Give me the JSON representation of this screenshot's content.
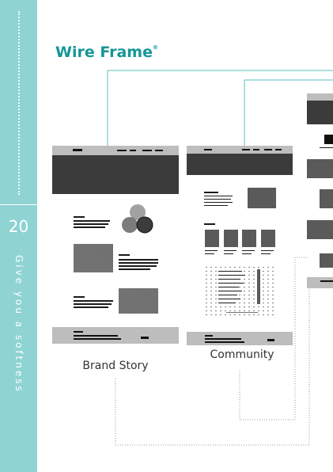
{
  "sidebar": {
    "page_number": "20",
    "tagline": "Give you a softness"
  },
  "title": {
    "text": "Wire Frame",
    "mark": "®"
  },
  "wireframes": [
    {
      "caption": "Brand Story"
    },
    {
      "caption": "Community"
    }
  ],
  "colors": {
    "sidebar": "#8fd3d3",
    "title": "#159696",
    "connector": "#5bc2c2",
    "wire_gray": "#5a5a5a",
    "wire_bar": "#bdbdbd"
  }
}
